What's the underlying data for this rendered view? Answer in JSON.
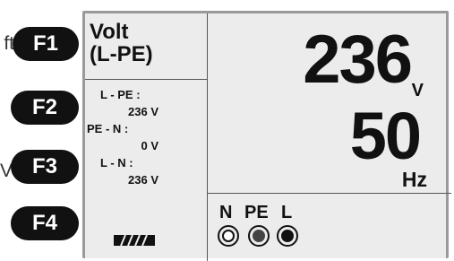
{
  "side_labels": {
    "f1_left": "ft",
    "f3_left": "V"
  },
  "function_keys": [
    "F1",
    "F2",
    "F3",
    "F4"
  ],
  "display": {
    "mode_line1": "Volt",
    "mode_line2": "(L-PE)",
    "readings": [
      {
        "key": "L - PE :",
        "value": "236 V"
      },
      {
        "key": "PE - N :",
        "value": "0 V"
      },
      {
        "key": "L - N :",
        "value": "236 V"
      }
    ],
    "voltage_value": "236",
    "voltage_unit": "V",
    "frequency_value": "50",
    "frequency_unit": "Hz",
    "terminals": [
      {
        "label": "N",
        "state": "open"
      },
      {
        "label": "PE",
        "state": "filled"
      },
      {
        "label": "L",
        "state": "filled"
      }
    ],
    "battery_icon": "battery-icon"
  },
  "colors": {
    "screen_bg": "#ececec",
    "key_bg": "#111111",
    "text": "#111111"
  }
}
